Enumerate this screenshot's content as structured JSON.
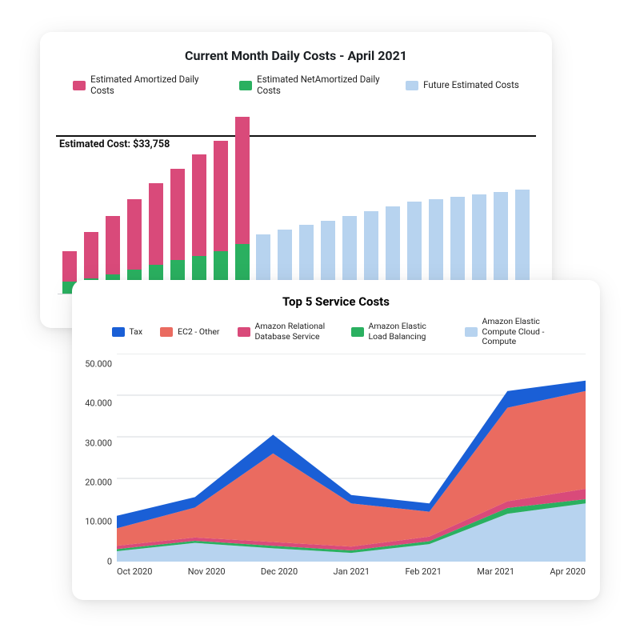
{
  "chart_data": [
    {
      "type": "bar",
      "title": "Current Month Daily Costs - April 2021",
      "budget_label": "Estimated Cost: $33,758",
      "budget_value": 33758,
      "ylim": [
        0,
        40000
      ],
      "legend": [
        {
          "name": "Estimated Amortized Daily Costs",
          "color": "#d94a7a"
        },
        {
          "name": "Estimated NetAmortized Daily Costs",
          "color": "#2ab060"
        },
        {
          "name": "Future Estimated Costs",
          "color": "#b7d3ef"
        }
      ],
      "series": {
        "amortized": [
          9000,
          13000,
          16500,
          20000,
          23500,
          26500,
          29500,
          32500,
          37500,
          0,
          0,
          0,
          0,
          0,
          0,
          0,
          0,
          0,
          0,
          0,
          0,
          0
        ],
        "net_amortized": [
          2500,
          3200,
          4000,
          5000,
          6000,
          7000,
          8000,
          9000,
          10500,
          0,
          0,
          0,
          0,
          0,
          0,
          0,
          0,
          0,
          0,
          0,
          0,
          0
        ],
        "future": [
          0,
          0,
          0,
          0,
          0,
          0,
          0,
          0,
          0,
          12500,
          13500,
          14500,
          15500,
          16500,
          17500,
          18500,
          19500,
          20000,
          20500,
          21000,
          21500,
          22000
        ]
      }
    },
    {
      "type": "area",
      "title": "Top 5 Service Costs",
      "ylim": [
        0,
        50000
      ],
      "yticks": [
        0,
        10000,
        20000,
        30000,
        40000,
        50000
      ],
      "ytick_labels": [
        "0",
        "10.000",
        "20.000",
        "30.000",
        "40.000",
        "50.000"
      ],
      "x": [
        "Oct 2020",
        "Nov 2020",
        "Dec 2020",
        "Jan 2021",
        "Feb 2021",
        "Mar 2021",
        "Apr 2020"
      ],
      "legend": [
        {
          "name": "Tax",
          "color": "#1a5fd6"
        },
        {
          "name": "EC2 - Other",
          "color": "#ea6b60"
        },
        {
          "name": "Amazon Relational Database Service",
          "color": "#d94a7a"
        },
        {
          "name": "Amazon Elastic Load Balancing",
          "color": "#2ab060"
        },
        {
          "name": "Amazon Elastic Compute Cloud - Compute",
          "color": "#b7d3ef"
        }
      ],
      "series": [
        {
          "name": "Amazon Elastic Compute Cloud - Compute",
          "color": "#b7d3ef",
          "values": [
            2500,
            4500,
            3200,
            2100,
            4200,
            11500,
            14000
          ]
        },
        {
          "name": "Amazon Elastic Load Balancing",
          "color": "#2ab060",
          "values": [
            500,
            500,
            600,
            600,
            700,
            1400,
            1000
          ]
        },
        {
          "name": "Amazon Relational Database Service",
          "color": "#d94a7a",
          "values": [
            800,
            800,
            900,
            900,
            1100,
            1600,
            2500
          ]
        },
        {
          "name": "EC2 - Other",
          "color": "#ea6b60",
          "values": [
            4200,
            7200,
            21300,
            10400,
            6000,
            22500,
            23500
          ]
        },
        {
          "name": "Tax",
          "color": "#1a5fd6",
          "values": [
            3000,
            2500,
            4500,
            2000,
            2000,
            4000,
            2500
          ]
        }
      ],
      "stacked_top": [
        11000,
        15500,
        30500,
        16000,
        14000,
        41000,
        43500
      ]
    }
  ]
}
